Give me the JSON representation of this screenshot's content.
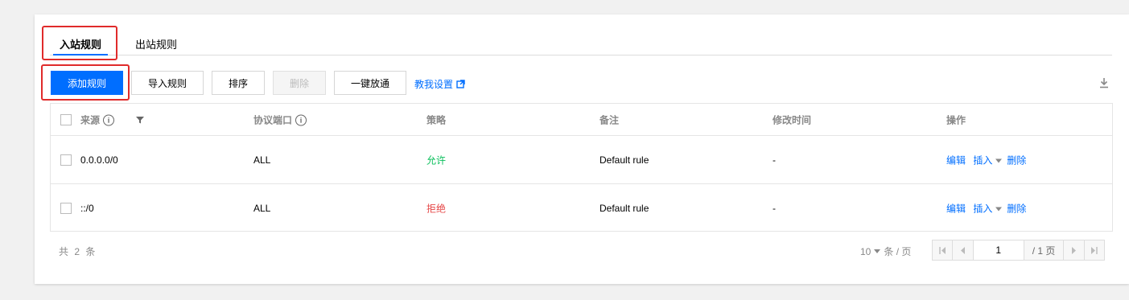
{
  "tabs": {
    "inbound": "入站规则",
    "outbound": "出站规则"
  },
  "toolbar": {
    "add": "添加规则",
    "import": "导入规则",
    "sort": "排序",
    "delete": "删除",
    "allow_all": "一键放通",
    "help": "教我设置"
  },
  "table": {
    "headers": {
      "source": "来源",
      "protocol_port": "协议端口",
      "policy": "策略",
      "remark": "备注",
      "modified": "修改时间",
      "actions": "操作"
    },
    "rows": [
      {
        "source": "0.0.0.0/0",
        "protocol_port": "ALL",
        "policy": "允许",
        "remark": "Default rule",
        "modified": "-",
        "edit": "编辑",
        "insert": "插入",
        "delete": "删除"
      },
      {
        "source": "::/0",
        "protocol_port": "ALL",
        "policy": "拒绝",
        "remark": "Default rule",
        "modified": "-",
        "edit": "编辑",
        "insert": "插入",
        "delete": "删除"
      }
    ]
  },
  "footer": {
    "total": "共 2 条",
    "page_size": "10",
    "per_page": "条 / 页",
    "current_page": "1",
    "total_pages": "/ 1 页"
  },
  "colors": {
    "primary": "#006eff",
    "allow": "#0abf5b",
    "deny": "#e54545",
    "highlight": "#e02b2b"
  }
}
